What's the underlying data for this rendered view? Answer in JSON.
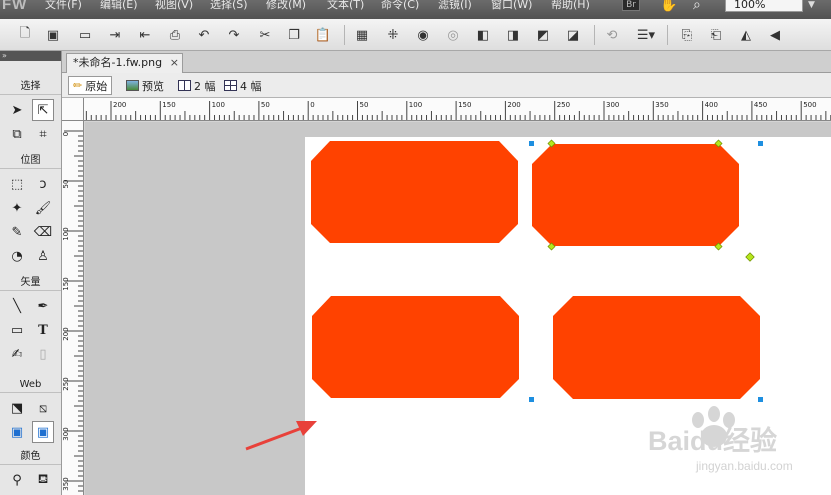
{
  "app": {
    "logo": "FW",
    "menus": [
      "文件(F)",
      "编辑(E)",
      "视图(V)",
      "选择(S)",
      "修改(M)",
      "文本(T)",
      "命令(C)",
      "滤镜(I)",
      "窗口(W)",
      "帮助(H)"
    ],
    "bridge_label": "Br",
    "zoom_value": "100%"
  },
  "toolbar": {
    "icons": [
      "new-icon",
      "save-icon",
      "open-icon",
      "import-icon",
      "export-icon",
      "print-icon",
      "undo-icon",
      "redo-icon",
      "cut-icon",
      "copy-icon",
      "paste-icon",
      "group-icon",
      "ungroup-icon",
      "join-icon",
      "split-icon",
      "bring-front-icon",
      "bring-forward-icon",
      "send-backward-icon",
      "send-back-icon",
      "rotate-icon",
      "align-icon",
      "symbol-icon",
      "export-area-icon",
      "flip-horizontal-icon",
      "flip-vertical-icon"
    ]
  },
  "tools_panel": {
    "sections": [
      "选择",
      "位图",
      "矢量",
      "Web",
      "颜色"
    ]
  },
  "document": {
    "tab_title": "*未命名-1.fw.png",
    "close_glyph": "×"
  },
  "view_bar": {
    "original": "原始",
    "preview": "预览",
    "two_up": "2 幅",
    "four_up": "4 幅"
  },
  "rulers": {
    "top_labels": [
      "200",
      "150",
      "100",
      "50",
      "0",
      "50",
      "100",
      "150",
      "200",
      "250",
      "300",
      "350",
      "400",
      "450",
      "500"
    ],
    "left_labels": [
      "0",
      "50",
      "100",
      "150",
      "200",
      "250",
      "300",
      "350"
    ]
  },
  "canvas": {
    "shape_color": "#ff4200",
    "background": "#ffffff",
    "workspace_color": "#c8c8c8",
    "handle_green": "#b5e61d",
    "handle_blue": "#1e8fe0",
    "arrow_color": "#e8413a"
  },
  "watermark": {
    "brand": "Baidu经验",
    "url": "jingyan.baidu.com"
  }
}
